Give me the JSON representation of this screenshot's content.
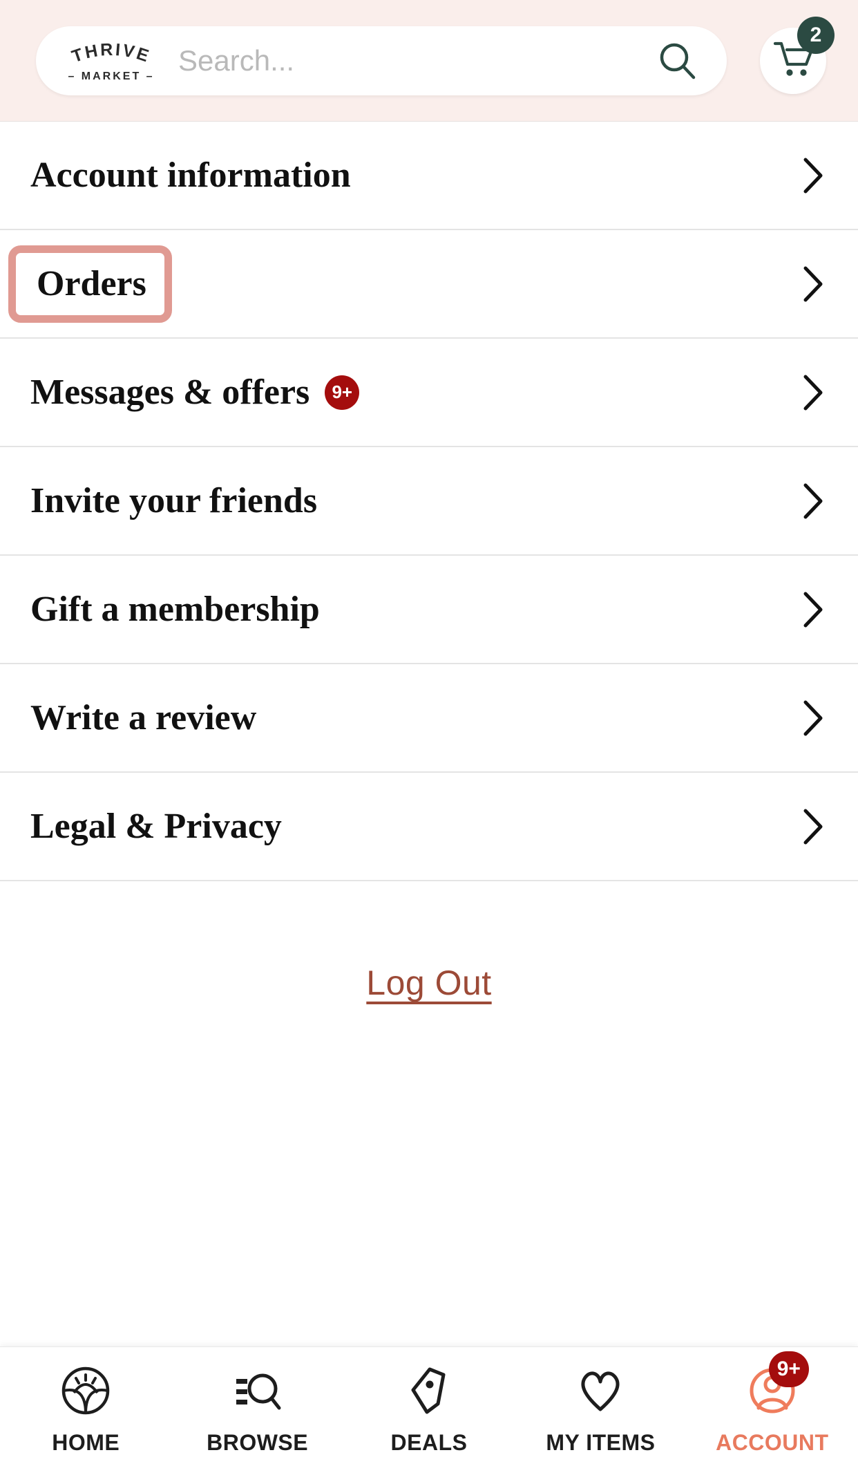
{
  "header": {
    "brand": {
      "line1": "THRIVE",
      "line2": "MARKET",
      "icon": "thrive-market-logo"
    },
    "search": {
      "placeholder": "Search...",
      "value": "",
      "icon": "search-icon"
    },
    "cart": {
      "icon": "shopping-cart-icon",
      "badge": "2",
      "badge_color": "#2b4a42"
    },
    "background_color": "#faeeeb"
  },
  "menu": {
    "items": [
      {
        "label": "Account information",
        "badge": null,
        "chevron": "chevron-right-icon",
        "highlighted": false
      },
      {
        "label": "Orders",
        "badge": null,
        "chevron": "chevron-right-icon",
        "highlighted": true
      },
      {
        "label": "Messages & offers",
        "badge": "9+",
        "chevron": "chevron-right-icon",
        "highlighted": false
      },
      {
        "label": "Invite your friends",
        "badge": null,
        "chevron": "chevron-right-icon",
        "highlighted": false
      },
      {
        "label": "Gift a membership",
        "badge": null,
        "chevron": "chevron-right-icon",
        "highlighted": false
      },
      {
        "label": "Write a review",
        "badge": null,
        "chevron": "chevron-right-icon",
        "highlighted": false
      },
      {
        "label": "Legal & Privacy",
        "badge": null,
        "chevron": "chevron-right-icon",
        "highlighted": false
      }
    ],
    "badge_color": "#a40d0d",
    "highlight_color": "#e09a92"
  },
  "logout": {
    "label": "Log Out",
    "color": "#9c4a37"
  },
  "bottom_nav": {
    "items": [
      {
        "label": "HOME",
        "icon": "sunrise-plant-icon",
        "active": false,
        "badge": null
      },
      {
        "label": "BROWSE",
        "icon": "list-search-icon",
        "active": false,
        "badge": null
      },
      {
        "label": "DEALS",
        "icon": "tag-icon",
        "active": false,
        "badge": null
      },
      {
        "label": "MY ITEMS",
        "icon": "heart-icon",
        "active": false,
        "badge": null
      },
      {
        "label": "ACCOUNT",
        "icon": "account-person-icon",
        "active": true,
        "badge": "9+"
      }
    ],
    "active_color": "#e87a5e",
    "badge_color": "#a40d0d"
  }
}
